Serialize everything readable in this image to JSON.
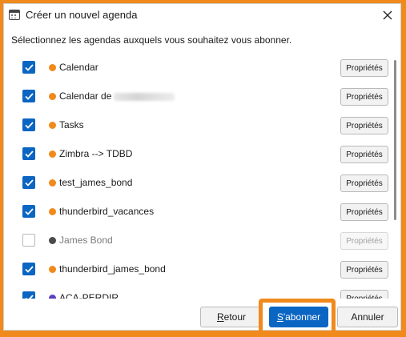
{
  "window": {
    "title": "Créer un nouvel agenda"
  },
  "instruction": "Sélectionnez les agendas auxquels vous souhaitez vous abonner.",
  "calendars": [
    {
      "name": "Calendar",
      "checked": true,
      "color": "#f08a1c",
      "disabled": false,
      "redacted_suffix": false
    },
    {
      "name": "Calendar de",
      "checked": true,
      "color": "#f08a1c",
      "disabled": false,
      "redacted_suffix": true
    },
    {
      "name": "Tasks",
      "checked": true,
      "color": "#f08a1c",
      "disabled": false,
      "redacted_suffix": false
    },
    {
      "name": "Zimbra --> TDBD",
      "checked": true,
      "color": "#f08a1c",
      "disabled": false,
      "redacted_suffix": false
    },
    {
      "name": "test_james_bond",
      "checked": true,
      "color": "#f08a1c",
      "disabled": false,
      "redacted_suffix": false
    },
    {
      "name": "thunderbird_vacances",
      "checked": true,
      "color": "#f08a1c",
      "disabled": false,
      "redacted_suffix": false
    },
    {
      "name": "James Bond",
      "checked": false,
      "color": "#4a4a4a",
      "disabled": true,
      "redacted_suffix": false
    },
    {
      "name": "thunderbird_james_bond",
      "checked": true,
      "color": "#f08a1c",
      "disabled": false,
      "redacted_suffix": false
    },
    {
      "name": "ACA-PERDIR",
      "checked": true,
      "color": "#5a3fc0",
      "disabled": false,
      "redacted_suffix": false
    }
  ],
  "properties_label": "Propriétés",
  "buttons": {
    "back": {
      "label": "Retour",
      "accesskey": "R"
    },
    "subscribe": {
      "label": "S'abonner",
      "accesskey": "S"
    },
    "cancel": {
      "label": "Annuler"
    }
  },
  "colors": {
    "accent": "#0b65c2",
    "highlight": "#f08a1c"
  }
}
